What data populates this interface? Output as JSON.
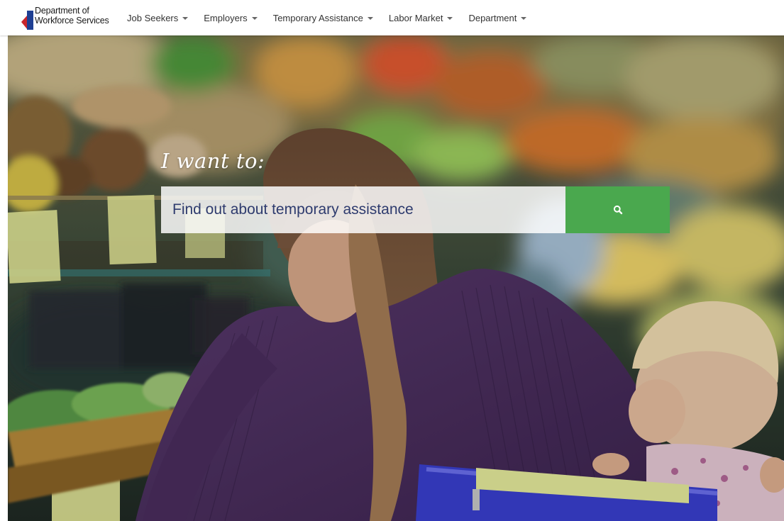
{
  "org": {
    "name_line1": "Department of",
    "name_line2": "Workforce Services",
    "brand_colors": {
      "red": "#c9252c",
      "blue": "#1f3f93"
    }
  },
  "nav": {
    "items": [
      {
        "label": "Job Seekers"
      },
      {
        "label": "Employers"
      },
      {
        "label": "Temporary Assistance"
      },
      {
        "label": "Labor Market"
      },
      {
        "label": "Department"
      }
    ]
  },
  "hero": {
    "heading": "I want to:",
    "search_placeholder": "Find out about temporary assistance",
    "search_button_icon": "search-icon",
    "accent_color": "#4aa84e"
  }
}
